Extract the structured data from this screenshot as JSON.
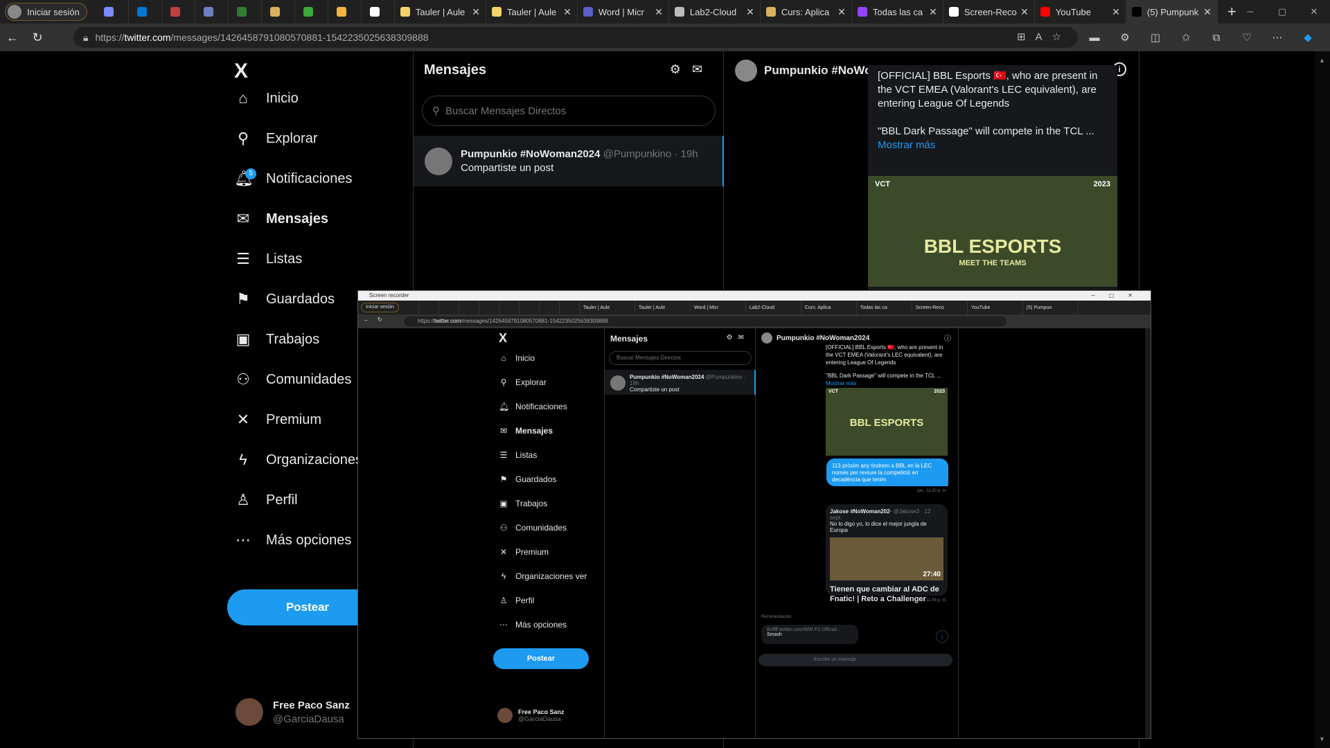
{
  "browser": {
    "profile_label": "Iniciar sesión",
    "tabs": [
      {
        "label": "",
        "color": "#7b8bff",
        "size": "sm"
      },
      {
        "label": "",
        "color": "#0078d4",
        "size": "sm"
      },
      {
        "label": "",
        "color": "#c04040",
        "size": "sm"
      },
      {
        "label": "",
        "color": "#6b7fbf",
        "size": "sm"
      },
      {
        "label": "",
        "color": "#2e7d32",
        "size": "sm"
      },
      {
        "label": "",
        "color": "#d6b35a",
        "size": "sm"
      },
      {
        "label": "",
        "color": "#3aa83a",
        "size": "sm"
      },
      {
        "label": "",
        "color": "#f3b33d",
        "size": "sm"
      },
      {
        "label": "",
        "color": "#ffffff",
        "size": "sm"
      },
      {
        "label": "Tauler | Aule",
        "color": "#f3d36b",
        "size": "lg"
      },
      {
        "label": "Tauler | Aule",
        "color": "#f3d36b",
        "size": "lg"
      },
      {
        "label": "Word | Micr",
        "color": "#5b5fc7",
        "size": "lg"
      },
      {
        "label": "Lab2-Cloud",
        "color": "#bbbbbb",
        "size": "lg"
      },
      {
        "label": "Curs: Aplica",
        "color": "#d6b35a",
        "size": "lg"
      },
      {
        "label": "Todas las ca",
        "color": "#9146ff",
        "size": "lg"
      },
      {
        "label": "Screen-Reco",
        "color": "#ffffff",
        "size": "lg"
      },
      {
        "label": "YouTube",
        "color": "#ff0000",
        "size": "lg"
      },
      {
        "label": "(5) Pumpunk",
        "color": "#000000",
        "size": "lg",
        "active": true
      }
    ],
    "url_prefix": "https://",
    "url_host": "twitter.com",
    "url_path": "/messages/1426458791080570881-1542235025638309888"
  },
  "nav": {
    "logo": "X",
    "items": [
      {
        "label": "Inicio",
        "icon": "home-icon",
        "glyph": "⌂"
      },
      {
        "label": "Explorar",
        "icon": "search-icon",
        "glyph": "⚲"
      },
      {
        "label": "Notificaciones",
        "icon": "bell-icon",
        "glyph": "🔔︎",
        "badge": "5"
      },
      {
        "label": "Mensajes",
        "icon": "mail-icon",
        "glyph": "✉",
        "bold": true
      },
      {
        "label": "Listas",
        "icon": "list-icon",
        "glyph": "☰"
      },
      {
        "label": "Guardados",
        "icon": "bookmark-icon",
        "glyph": "⚑"
      },
      {
        "label": "Trabajos",
        "icon": "briefcase-icon",
        "glyph": "▣"
      },
      {
        "label": "Comunidades",
        "icon": "people-icon",
        "glyph": "⚇"
      },
      {
        "label": "Premium",
        "icon": "x-icon",
        "glyph": "✕"
      },
      {
        "label": "Organizaciones",
        "icon": "bolt-icon",
        "glyph": "ϟ"
      },
      {
        "label": "Perfil",
        "icon": "person-icon",
        "glyph": "♙"
      },
      {
        "label": "Más opciones",
        "icon": "more-icon",
        "glyph": "⋯"
      }
    ],
    "post_label": "Postear",
    "user_name": "Free Paco Sanz",
    "user_handle": "@GarciaDausa"
  },
  "messages": {
    "title": "Mensajes",
    "search_placeholder": "Buscar Mensajes Directos",
    "conversation": {
      "name": "Pumpunkio #NoWoman2024",
      "handle": "@Pumpunkino · 19h",
      "preview": "Compartiste un post"
    }
  },
  "chat": {
    "header_name": "Pumpunkio #NoWoman2024",
    "card_text_1": "[OFFICIAL] BBL Esports 🇹🇷, who are present in the VCT EMEA (Valorant's LEC equivalent), are entering League Of Legends",
    "card_text_2": "\"BBL Dark Passage\" will compete in the TCL ...",
    "show_more": "Mostrar más",
    "thumb_left": "VCT",
    "thumb_right": "2023",
    "thumb_title": "BBL ESPORTS",
    "thumb_sub": "MEET THE TEAMS"
  },
  "recorder": {
    "window_title": "Screen recorder",
    "nav_items": [
      "Inicio",
      "Explorar",
      "Notificaciones",
      "Mensajes",
      "Listas",
      "Guardados",
      "Trabajos",
      "Comunidades",
      "Premium",
      "Organizaciones ver",
      "Perfil",
      "Más opciones"
    ],
    "tab_labels": [
      "Tauler | Aule",
      "Tauler | Aule",
      "Word | Micr",
      "Lab2-Cloud",
      "Curs: Aplica",
      "Todas las ca",
      "Screen-Reco",
      "YouTube",
      "(5) Pumpun"
    ],
    "bubble_text": "113 pròxim any tindrem a BBL en la LEC només per reviure la competició en decadència que tenim",
    "ts1": "jue., 11:30 p. m.",
    "quote_author": "Jakose #NoWoman202·",
    "quote_handle": "@Jakose2 · 12 sept.",
    "quote_text": "No lo digo yo, lo dice el mejor jungla de Europa",
    "video_duration": "27:40",
    "video_title": "Tienen que cambiar al ADC de Fnatic! | Reto a Challenger",
    "ts2": "jue., 11:58 p. m.",
    "recommended": "Recomendación",
    "link_url": "Boffff twitter.com/WW FS Official...",
    "link_name": "Smash",
    "input_placeholder": "Escribe un mensaje"
  }
}
